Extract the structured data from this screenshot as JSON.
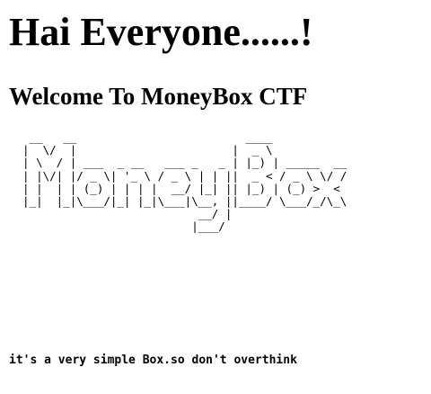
{
  "heading": "Hai Everyone......!",
  "subheading": "Welcome To MoneyBox CTF",
  "ascii_art": "   __   __                         ____\n  |  \\/  |                       |  _ \\\n  | \\  / | ___  _ __   ___ _   _ | |_) | _____  __\n  | |\\/| |/ _ \\| '_ \\ / _ \\ | | ||  _ < / _ \\ \\/ /\n  | |  | | (_) | | | |  __/ |_| || |_) | (_) >  <\n  |_|  |_|\\___/|_| |_|\\___|\\__, ||____/ \\___/_/\\_\\\n                            __/ |\n                           |___/",
  "tagline": "it's a very simple Box.so don't overthink"
}
